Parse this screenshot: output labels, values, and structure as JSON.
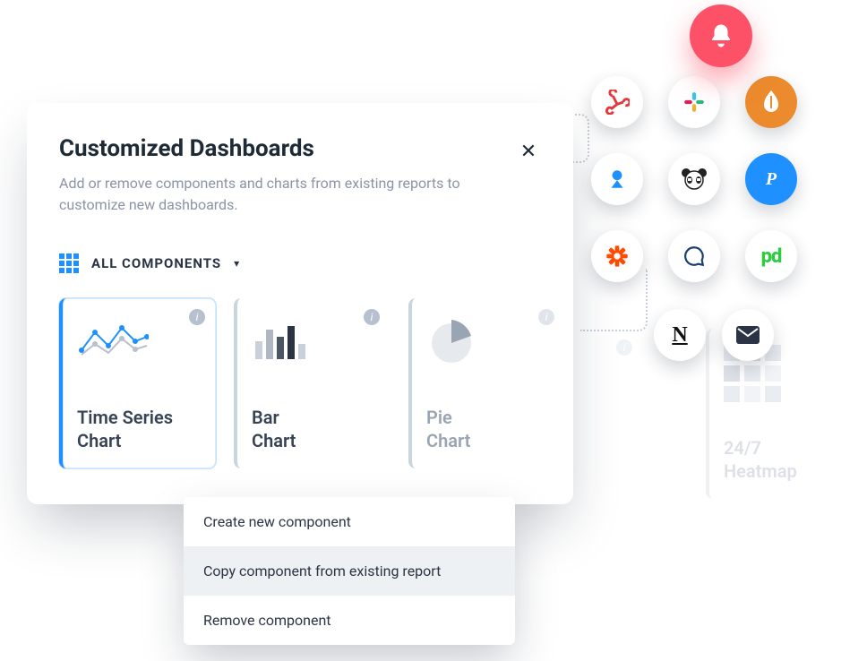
{
  "panel": {
    "title": "Customized Dashboards",
    "description": "Add or remove components and charts from existing reports to customize new dashboards.",
    "filter_label": "ALL COMPONENTS"
  },
  "cards": [
    {
      "title_line1": "Time Series",
      "title_line2": "Chart"
    },
    {
      "title_line1": "Bar",
      "title_line2": "Chart"
    },
    {
      "title_line1": "Pie",
      "title_line2": "Chart"
    },
    {
      "title_line1": "24/7",
      "title_line2": "Heatmap"
    }
  ],
  "menu": {
    "items": [
      "Create new component",
      "Copy component from existing report",
      "Remove component"
    ]
  },
  "integrations": [
    {
      "name": "webhooks"
    },
    {
      "name": "slack"
    },
    {
      "name": "opsgenie"
    },
    {
      "name": "teams"
    },
    {
      "name": "pandadoc"
    },
    {
      "name": "pushover"
    },
    {
      "name": "zapier"
    },
    {
      "name": "chat"
    },
    {
      "name": "pagerduty"
    },
    {
      "name": "notion"
    },
    {
      "name": "email"
    }
  ],
  "notification": {
    "icon": "bell"
  }
}
